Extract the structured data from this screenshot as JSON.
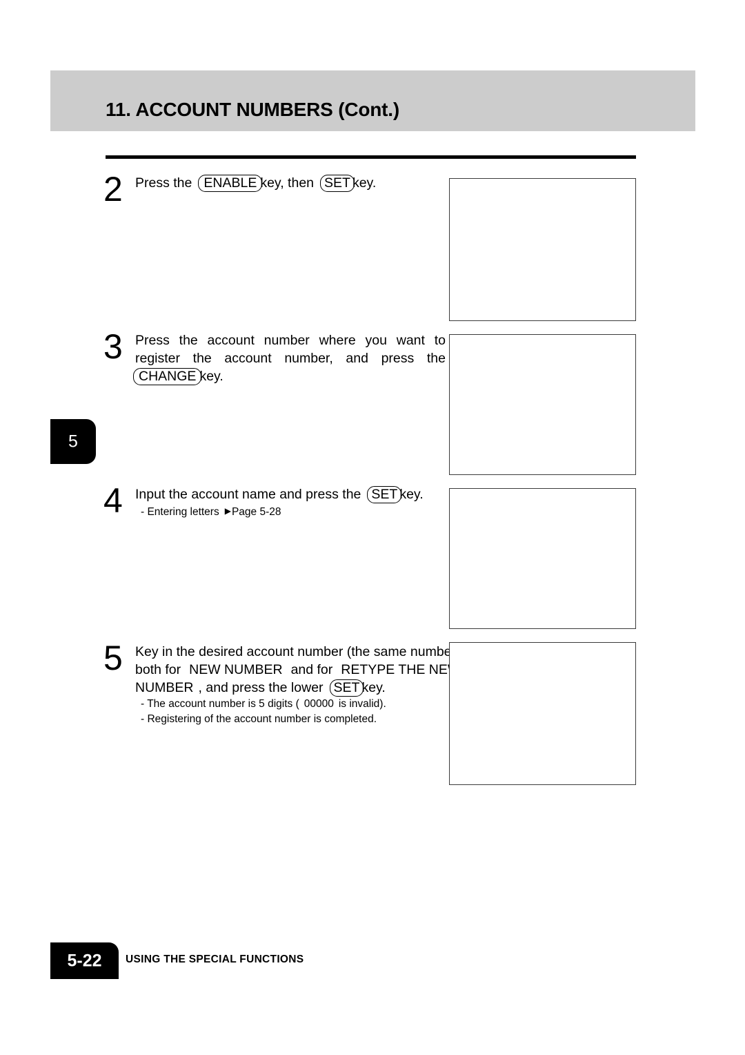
{
  "header": {
    "title": "11. ACCOUNT NUMBERS (Cont.)"
  },
  "chapter_tab": {
    "number": "5"
  },
  "steps": [
    {
      "number": "2",
      "lines": [
        {
          "parts": [
            {
              "type": "text",
              "value": "Press the"
            },
            {
              "type": "gap"
            },
            {
              "type": "key",
              "value": "ENABLE"
            },
            {
              "type": "text",
              "value": "key, then"
            },
            {
              "type": "gap"
            },
            {
              "type": "key",
              "value": "SET"
            },
            {
              "type": "text",
              "value": "key."
            }
          ]
        }
      ],
      "notes": []
    },
    {
      "number": "3",
      "lines": [
        {
          "justify": true,
          "parts": [
            {
              "type": "text",
              "value": "Press the account number where you want to"
            }
          ]
        },
        {
          "justify": true,
          "parts": [
            {
              "type": "text",
              "value": "register the account number, and press the"
            }
          ]
        },
        {
          "parts": [
            {
              "type": "key",
              "value": "CHANGE"
            },
            {
              "type": "text",
              "value": "key."
            }
          ]
        }
      ],
      "notes": []
    },
    {
      "number": "4",
      "lines": [
        {
          "parts": [
            {
              "type": "text",
              "value": "Input the account name and press the"
            },
            {
              "type": "gap"
            },
            {
              "type": "key",
              "value": "SET"
            },
            {
              "type": "text",
              "value": "key."
            }
          ]
        }
      ],
      "notes": [
        {
          "parts": [
            {
              "type": "text",
              "value": "- Entering letters"
            },
            {
              "type": "gap-s"
            },
            {
              "type": "arrow",
              "value": "▶"
            },
            {
              "type": "text",
              "value": "Page 5-28"
            }
          ]
        }
      ]
    },
    {
      "number": "5",
      "lines": [
        {
          "parts": [
            {
              "type": "text",
              "value": "Key in the desired account number (the same number)"
            }
          ]
        },
        {
          "parts": [
            {
              "type": "text",
              "value": "both for"
            },
            {
              "type": "gap"
            },
            {
              "type": "text",
              "value": "NEW NUMBER"
            },
            {
              "type": "gap"
            },
            {
              "type": "text",
              "value": "and for"
            },
            {
              "type": "gap"
            },
            {
              "type": "text",
              "value": "RETYPE THE NEW"
            }
          ]
        },
        {
          "parts": [
            {
              "type": "text",
              "value": "NUMBER"
            },
            {
              "type": "gap-s"
            },
            {
              "type": "text",
              "value": ", and press the lower"
            },
            {
              "type": "gap"
            },
            {
              "type": "key",
              "value": "SET"
            },
            {
              "type": "text",
              "value": "key."
            }
          ]
        }
      ],
      "notes": [
        {
          "parts": [
            {
              "type": "text",
              "value": "- The account number is 5 digits ("
            },
            {
              "type": "gap-s"
            },
            {
              "type": "text",
              "value": "00000"
            },
            {
              "type": "gap-s"
            },
            {
              "type": "text",
              "value": "is invalid)."
            }
          ]
        },
        {
          "parts": [
            {
              "type": "text",
              "value": "- Registering of the account number is completed."
            }
          ]
        }
      ]
    }
  ],
  "illustrations": [
    {
      "label": "illustration-step-2"
    },
    {
      "label": "illustration-step-3"
    },
    {
      "label": "illustration-step-4"
    },
    {
      "label": "illustration-step-5"
    }
  ],
  "footer": {
    "page_number": "5-22",
    "section_label": "USING THE SPECIAL FUNCTIONS"
  }
}
